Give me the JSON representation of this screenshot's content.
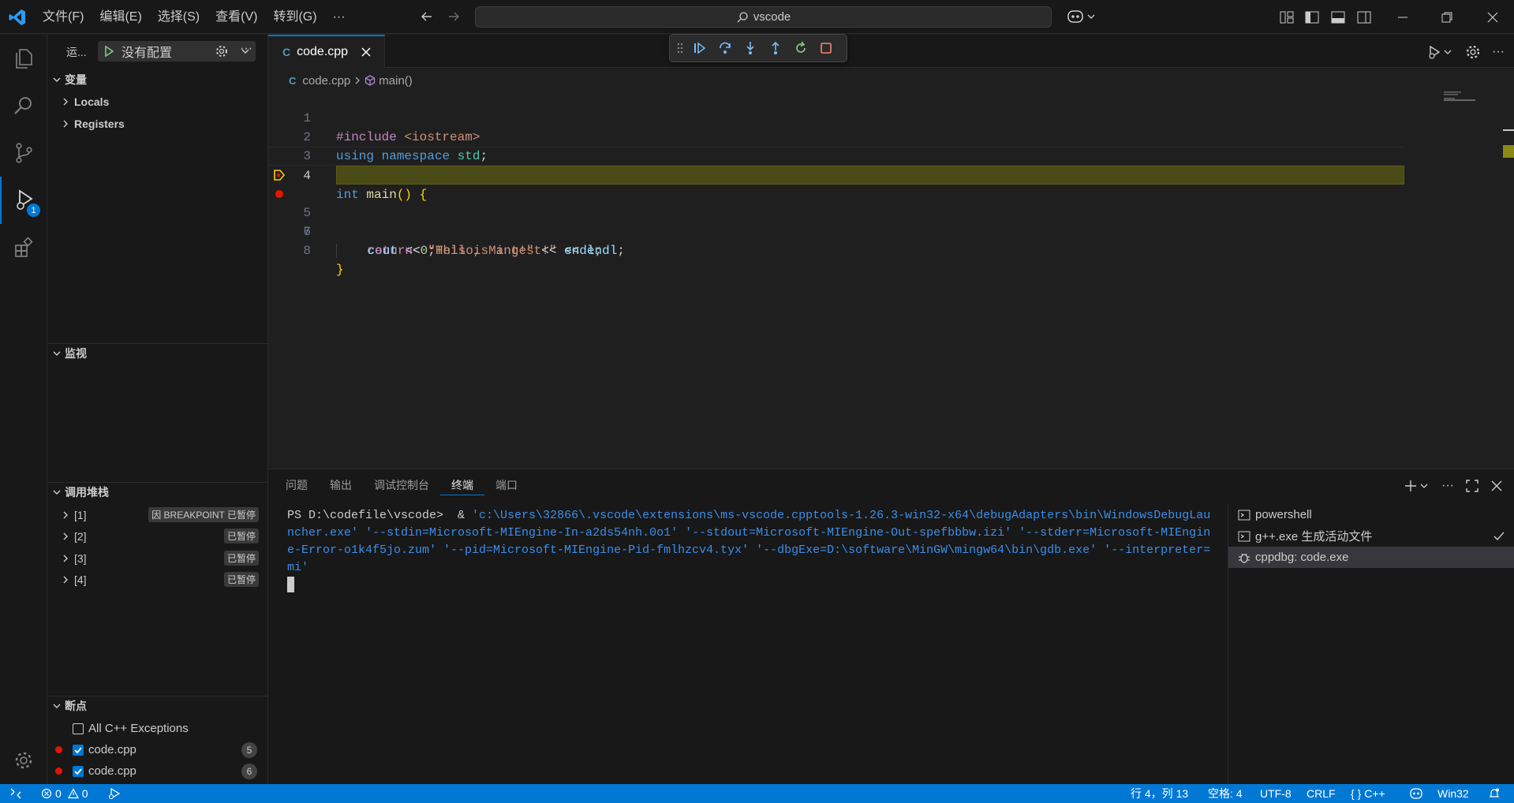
{
  "titlebar": {
    "menus": [
      "文件(F)",
      "编辑(E)",
      "选择(S)",
      "查看(V)",
      "转到(G)",
      "···"
    ],
    "search_text": "vscode"
  },
  "activity": {
    "debug_badge": "1"
  },
  "sidebar": {
    "title": "运...",
    "config_label": "没有配置",
    "variables_header": "变量",
    "variables": [
      "Locals",
      "Registers"
    ],
    "watch_header": "监视",
    "callstack_header": "调用堆栈",
    "callstack": [
      {
        "label": "[1]",
        "status": "因 BREAKPOINT 已暂停"
      },
      {
        "label": "[2]",
        "status": "已暂停"
      },
      {
        "label": "[3]",
        "status": "已暂停"
      },
      {
        "label": "[4]",
        "status": "已暂停"
      }
    ],
    "breakpoints_header": "断点",
    "breakpoints": [
      {
        "label": "All C++ Exceptions",
        "checked": false,
        "line": ""
      },
      {
        "label": "code.cpp",
        "checked": true,
        "line": "5"
      },
      {
        "label": "code.cpp",
        "checked": true,
        "line": "6"
      }
    ]
  },
  "editor": {
    "tab_label": "code.cpp",
    "breadcrumb_file": "code.cpp",
    "breadcrumb_symbol": "main()",
    "line_numbers": [
      "1",
      "2",
      "3",
      "4",
      "5",
      "6",
      "7",
      "8"
    ],
    "current_line": 4,
    "paused_line": 5,
    "breakpoint_line": 6
  },
  "panel": {
    "tabs": [
      "问题",
      "输出",
      "调试控制台",
      "终端",
      "端口"
    ],
    "active_tab": "终端",
    "terminal_prompt": "PS D:\\codefile\\vscode>  & ",
    "terminal_lines": [
      "'c:\\Users\\32866\\.vscode\\extensions\\ms-vscode.cpptools-1.26.3-win32-x64\\debugAdapters\\bin\\WindowsDebugLau",
      "ncher.exe' '--stdin=Microsoft-MIEngine-In-a2ds54nh.0o1' '--stdout=Microsoft-MIEngine-Out-spefbbbw.izi' '--stderr=Microsoft-MIEngin",
      "e-Error-o1k4f5jo.zum' '--pid=Microsoft-MIEngine-Pid-fmlhzcv4.tyx' '--dbgExe=D:\\software\\MinGW\\mingw64\\bin\\gdb.exe' '--interpreter=",
      "mi'"
    ],
    "terminals": [
      "powershell",
      "g++.exe 生成活动文件",
      "cppdbg: code.exe"
    ]
  },
  "statusbar": {
    "errors": "0",
    "warnings": "0",
    "position": "行 4，列 13",
    "spaces": "空格: 4",
    "encoding": "UTF-8",
    "eol": "CRLF",
    "language": "C++",
    "platform": "Win32"
  },
  "colors": {
    "accent": "#0078d4",
    "breakpoint": "#e51400",
    "paused_line_bg": "#4b4b18"
  }
}
